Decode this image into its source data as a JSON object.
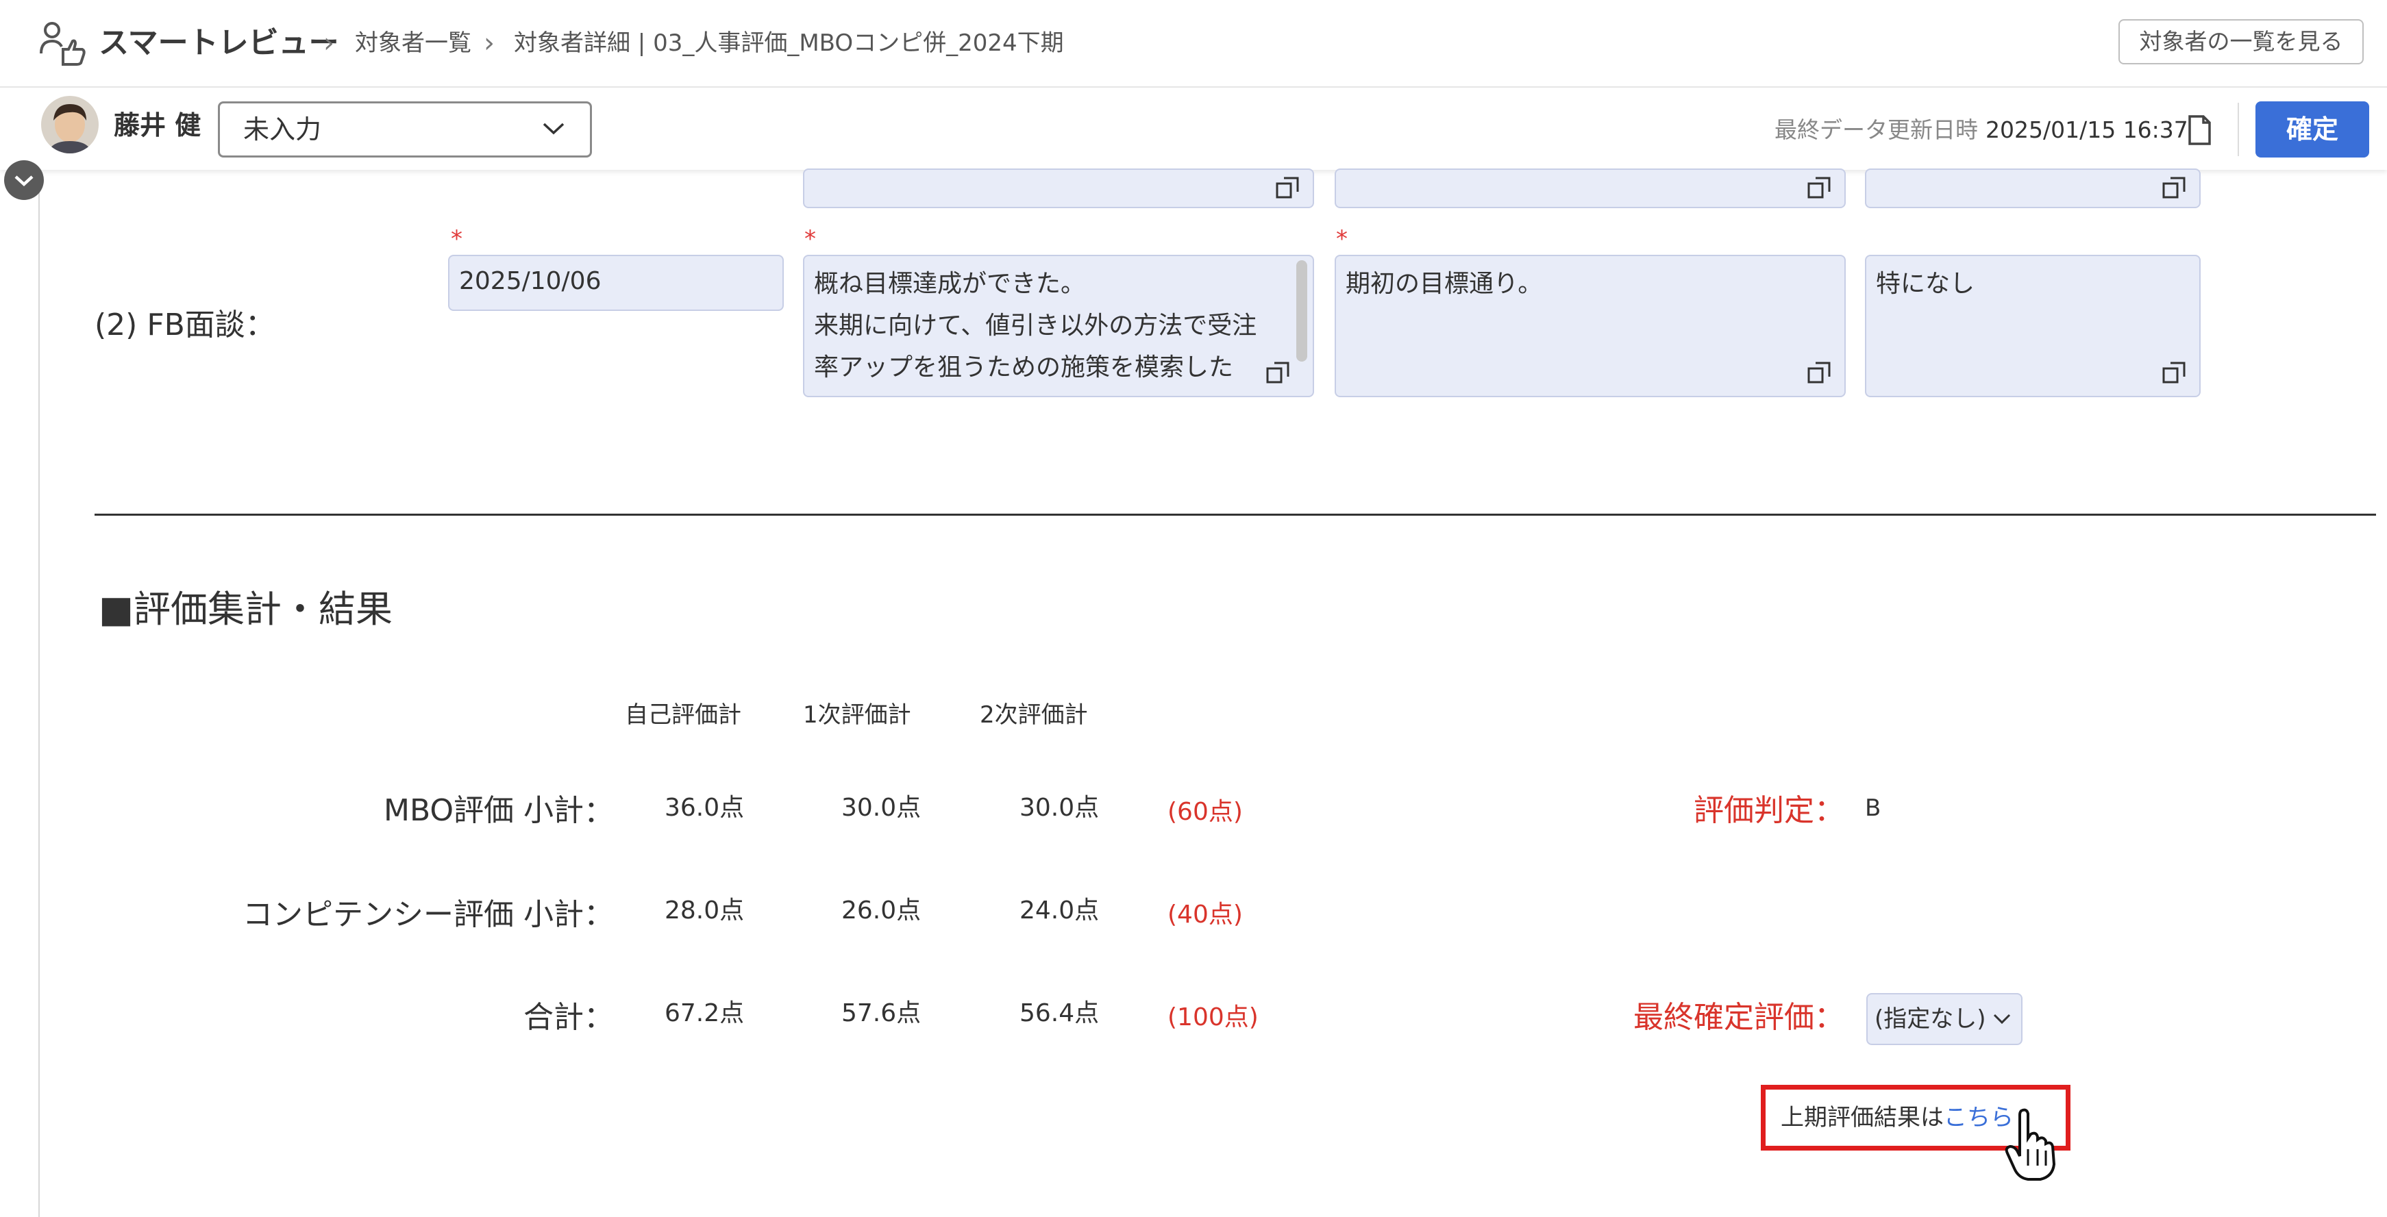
{
  "header": {
    "app_title": "スマートレビュー",
    "breadcrumbs": [
      "対象者一覧",
      "対象者詳細 | 03_人事評価_MBOコンピ併_2024下期"
    ],
    "view_list_button": "対象者の一覧を見る"
  },
  "subheader": {
    "user_name": "藤井 健",
    "status_value": "未入力",
    "updated_label": "最終データ更新日時",
    "updated_value": "2025/01/15 16:37",
    "confirm_button": "確定"
  },
  "fb_interview": {
    "label": "(2) FB面談：",
    "required_mark": "*",
    "date_value": "2025/10/06",
    "comment1": "概ね目標達成ができた。\n来期に向けて、値引き以外の方法で受注\n率アップを狙うための施策を模索した",
    "comment2": "期初の目標通り。",
    "comment3": "特になし"
  },
  "summary": {
    "section_title": "■評価集計・結果",
    "columns": [
      "自己評価計",
      "1次評価計",
      "2次評価計"
    ],
    "rows": [
      {
        "label": "MBO評価 小計",
        "colon": "：",
        "values": [
          "36.0点",
          "30.0点",
          "30.0点"
        ],
        "max": "(60点)"
      },
      {
        "label": "コンピテンシー評価 小計",
        "colon": "：",
        "values": [
          "28.0点",
          "26.0点",
          "24.0点"
        ],
        "max": "(40点)"
      },
      {
        "label": "合計",
        "colon": "：",
        "values": [
          "67.2点",
          "57.6点",
          "56.4点"
        ],
        "max": "(100点)"
      }
    ],
    "grade_label": "評価判定：",
    "grade_value": "B",
    "final_label": "最終確定評価：",
    "final_value": "(指定なし)",
    "prev_text": "上期評価結果は",
    "prev_link": "こちら"
  },
  "colors": {
    "accent": "#3a6fd8",
    "required": "#e03a3a",
    "highlight": "#e01e1e",
    "field_bg": "#e8ecf8"
  }
}
